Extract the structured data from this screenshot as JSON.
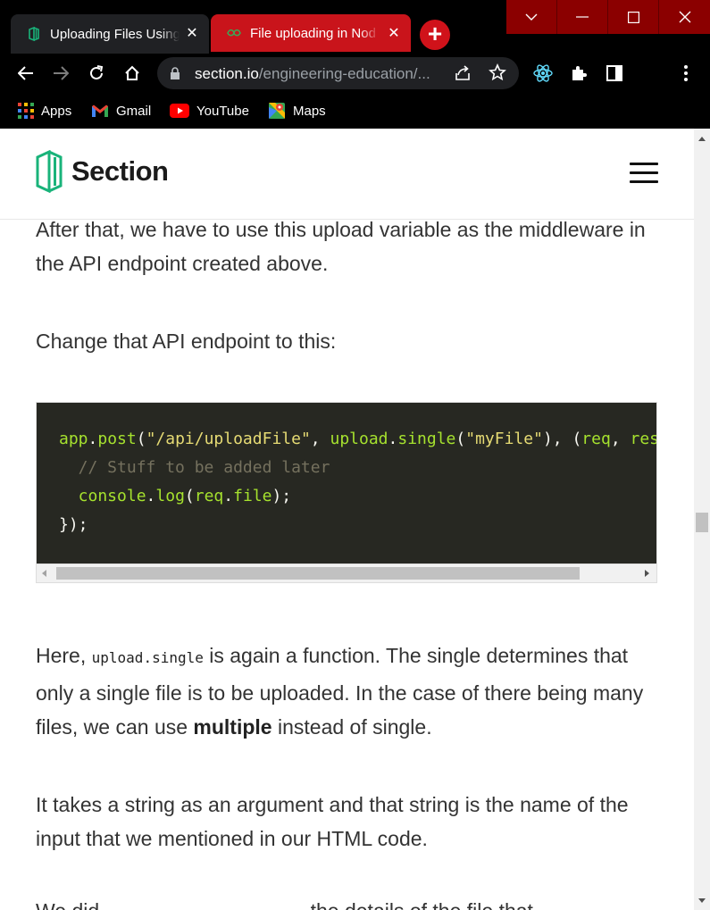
{
  "browser": {
    "tabs": [
      {
        "title": "Uploading Files Using",
        "favicon": "section-logo-icon",
        "active": true
      },
      {
        "title": "File uploading in Nod",
        "favicon": "geeksforgeeks-icon",
        "active": false
      }
    ],
    "new_tab_label": "+",
    "url_host": "section.io",
    "url_path": "/engineering-education/...",
    "bookmarks": [
      {
        "label": "Apps",
        "icon": "apps-grid-icon"
      },
      {
        "label": "Gmail",
        "icon": "gmail-icon"
      },
      {
        "label": "YouTube",
        "icon": "youtube-icon"
      },
      {
        "label": "Maps",
        "icon": "maps-icon"
      }
    ],
    "colors": {
      "active_tab_accent": "#c9141b",
      "window_controls": "#8b0000"
    }
  },
  "site": {
    "brand": "Section",
    "brand_color": "#19b37a"
  },
  "article": {
    "p1": "After that, we have to use this upload variable as the middleware in the API endpoint created above.",
    "p2": "Change that API endpoint to this:",
    "code": {
      "l1": {
        "t1": "app",
        "t2": ".",
        "t3": "post",
        "t4": "(",
        "t5": "\"/api/uploadFile\"",
        "t6": ", ",
        "t7": "upload",
        "t8": ".",
        "t9": "single",
        "t10": "(",
        "t11": "\"myFile\"",
        "t12": "), (",
        "t13": "req",
        "t14": ", ",
        "t15": "res"
      },
      "l2": "  // Stuff to be added later",
      "l3": {
        "t1": "  console",
        "t2": ".",
        "t3": "log",
        "t4": "(",
        "t5": "req",
        "t6": ".",
        "t7": "file",
        "t8": ");"
      },
      "l4": "});"
    },
    "p3": {
      "a": "Here, ",
      "code": "upload.single",
      "b": " is again a function. The single determines that only a single file is to be uploaded. In the case of there being many files, we can use ",
      "bold": "multiple",
      "c": " instead of single."
    },
    "p4": "It takes a string as an argument and that string is the name of the input that we mentioned in our HTML code.",
    "p5": "We did                                     the details of the file that"
  }
}
